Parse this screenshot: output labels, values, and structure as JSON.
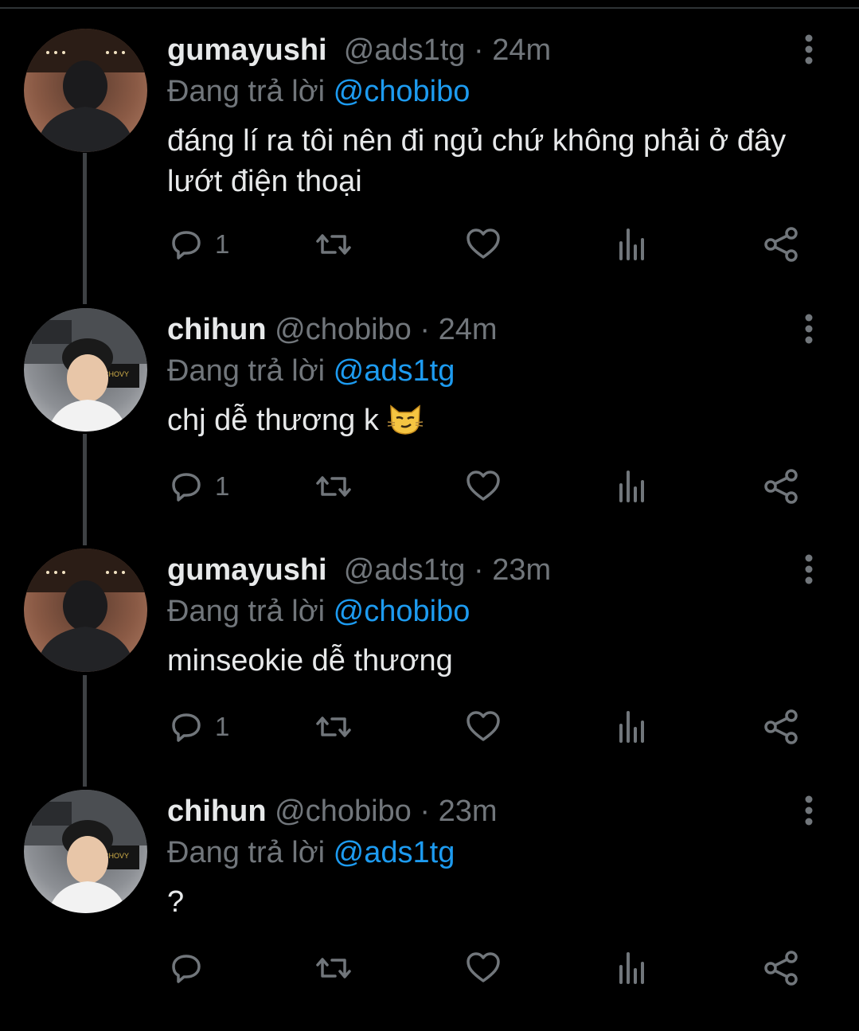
{
  "reply_prefix": "Đang trả lời",
  "colors": {
    "background": "#000000",
    "muted": "#71767b",
    "accent": "#1d9bf0",
    "text": "#e7e9ea"
  },
  "icons": {
    "reply": "reply-icon",
    "retweet": "retweet-icon",
    "like": "like-icon",
    "views": "views-icon",
    "share": "share-icon",
    "more": "more-vertical-icon"
  },
  "tweets": [
    {
      "name": "gumayushi",
      "handle": "@ads1tg",
      "time": "24m",
      "replying_to": "@chobibo",
      "text": "đáng lí ra tôi nên đi ngủ chứ không phải ở đây lướt điện thoại",
      "reply_count": "1"
    },
    {
      "name": "chihun",
      "handle": "@chobibo",
      "time": "24m",
      "replying_to": "@ads1tg",
      "text": "chj dễ thương k",
      "emoji": "smirking-cat",
      "reply_count": "1"
    },
    {
      "name": "gumayushi",
      "handle": "@ads1tg",
      "time": "23m",
      "replying_to": "@chobibo",
      "text": "minseokie dễ thương",
      "reply_count": "1"
    },
    {
      "name": "chihun",
      "handle": "@chobibo",
      "time": "23m",
      "replying_to": "@ads1tg",
      "text": "?",
      "reply_count": ""
    }
  ]
}
